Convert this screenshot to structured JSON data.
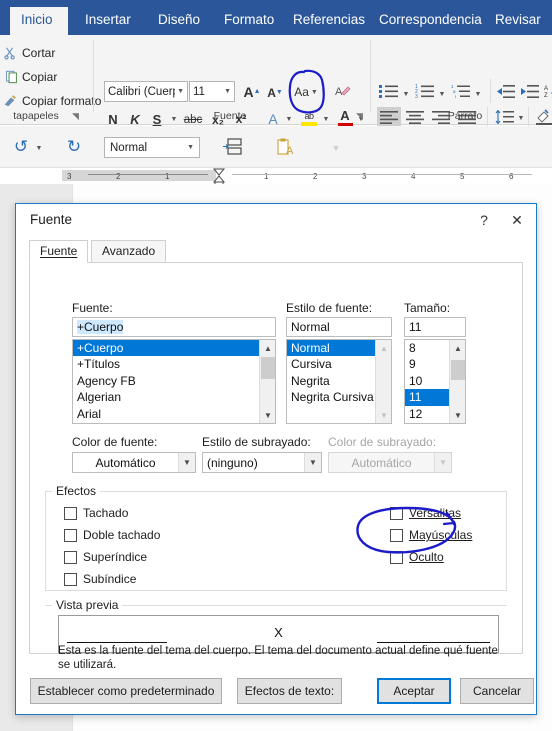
{
  "colors": {
    "ribbon_blue": "#2b579a",
    "accent_blue": "#0078d7",
    "annotation_blue": "#1b1bc9",
    "highlight_yellow": "#ffe600",
    "font_color_red": "#d40000",
    "dialog_border": "#1a79c8"
  },
  "ribbon": {
    "tabs": [
      {
        "label": "Inicio",
        "active": true
      },
      {
        "label": "Insertar",
        "active": false
      },
      {
        "label": "Diseño",
        "active": false
      },
      {
        "label": "Formato",
        "active": false
      },
      {
        "label": "Referencias",
        "active": false
      },
      {
        "label": "Correspondencia",
        "active": false
      },
      {
        "label": "Revisar",
        "active": false
      }
    ],
    "clipboard": {
      "group_label": "tapapeles",
      "cut": "Cortar",
      "copy": "Copiar",
      "format_painter": "Copiar formato",
      "launcher": "dialog-launcher"
    },
    "font_group": {
      "group_label": "Fuente",
      "font_name": "Calibri (Cuerpo",
      "font_size": "11",
      "grow_font": "A",
      "shrink_font": "A",
      "change_case": "Aa",
      "clear_formatting": "clear-format-icon",
      "bold": "N",
      "italic": "K",
      "underline": "S",
      "strikethrough": "abc",
      "subscript": "x₂",
      "superscript": "x²",
      "text_effects": "A",
      "highlight": "ab",
      "font_color": "A",
      "launcher": "dialog-launcher"
    },
    "paragraph_group": {
      "group_label": "Párrafo",
      "bullets": "bullet-list-icon",
      "numbering": "numbered-list-icon",
      "multilevel": "multilevel-list-icon",
      "decrease_indent": "decrease-indent-icon",
      "increase_indent": "increase-indent-icon",
      "sort": "sort-icon",
      "align_left": "align-left-icon",
      "align_center": "align-center-icon",
      "align_right": "align-right-icon",
      "justify": "justify-icon",
      "line_spacing": "line-spacing-icon",
      "shading": "shading-icon"
    }
  },
  "quickbar": {
    "undo": "undo-icon",
    "redo": "redo-icon",
    "style_value": "Normal",
    "table_icon": "table-icon",
    "paste_icon": "paste-options-icon"
  },
  "ruler": {
    "ticks": [
      "3",
      "2",
      "1",
      "1",
      "2",
      "3",
      "4",
      "5",
      "6"
    ]
  },
  "dialog": {
    "title": "Fuente",
    "help_button": "?",
    "close_button": "✕",
    "tabs": [
      {
        "label": "Fuente",
        "accel": "u",
        "active": true
      },
      {
        "label": "Avanzado",
        "accel": "A",
        "active": false
      }
    ],
    "font": {
      "label": "Fuente:",
      "value": "+Cuerpo",
      "items": [
        "+Cuerpo",
        "+Títulos",
        "Agency FB",
        "Algerian",
        "Arial"
      ],
      "selected_index": 0
    },
    "style": {
      "label": "Estilo de fuente:",
      "value": "Normal",
      "items": [
        "Normal",
        "Cursiva",
        "Negrita",
        "Negrita Cursiva"
      ],
      "selected_index": 0
    },
    "size": {
      "label": "Tamaño:",
      "value": "11",
      "items": [
        "8",
        "9",
        "10",
        "11",
        "12"
      ],
      "selected_index": 3
    },
    "font_color": {
      "label": "Color de fuente:",
      "value": "Automático"
    },
    "underline_style": {
      "label": "Estilo de subrayado:",
      "value": "(ninguno)"
    },
    "underline_color": {
      "label": "Color de subrayado:",
      "value": "Automático",
      "disabled": true
    },
    "effects": {
      "group_label": "Efectos",
      "left": [
        {
          "label": "Tachado",
          "checked": false
        },
        {
          "label": "Doble tachado",
          "checked": false
        },
        {
          "label": "Superíndice",
          "checked": false
        },
        {
          "label": "Subíndice",
          "checked": false
        }
      ],
      "right": [
        {
          "label": "Versalitas",
          "checked": false
        },
        {
          "label": "Mayúsculas",
          "checked": false
        },
        {
          "label": "Oculto",
          "checked": false
        }
      ]
    },
    "preview": {
      "group_label": "Vista previa",
      "sample_text": "X",
      "note": "Esta es la fuente del tema del cuerpo. El tema del documento actual define qué fuente se utilizará."
    },
    "buttons": {
      "set_default": "Establecer como predeterminado",
      "text_effects": "Efectos de texto:",
      "ok": "Aceptar",
      "cancel": "Cancelar"
    }
  },
  "annotations": [
    {
      "name": "highlight-button-circle",
      "shape": "hand-drawn-ellipse"
    },
    {
      "name": "oculto-checkbox-circle",
      "shape": "hand-drawn-ellipse"
    }
  ]
}
